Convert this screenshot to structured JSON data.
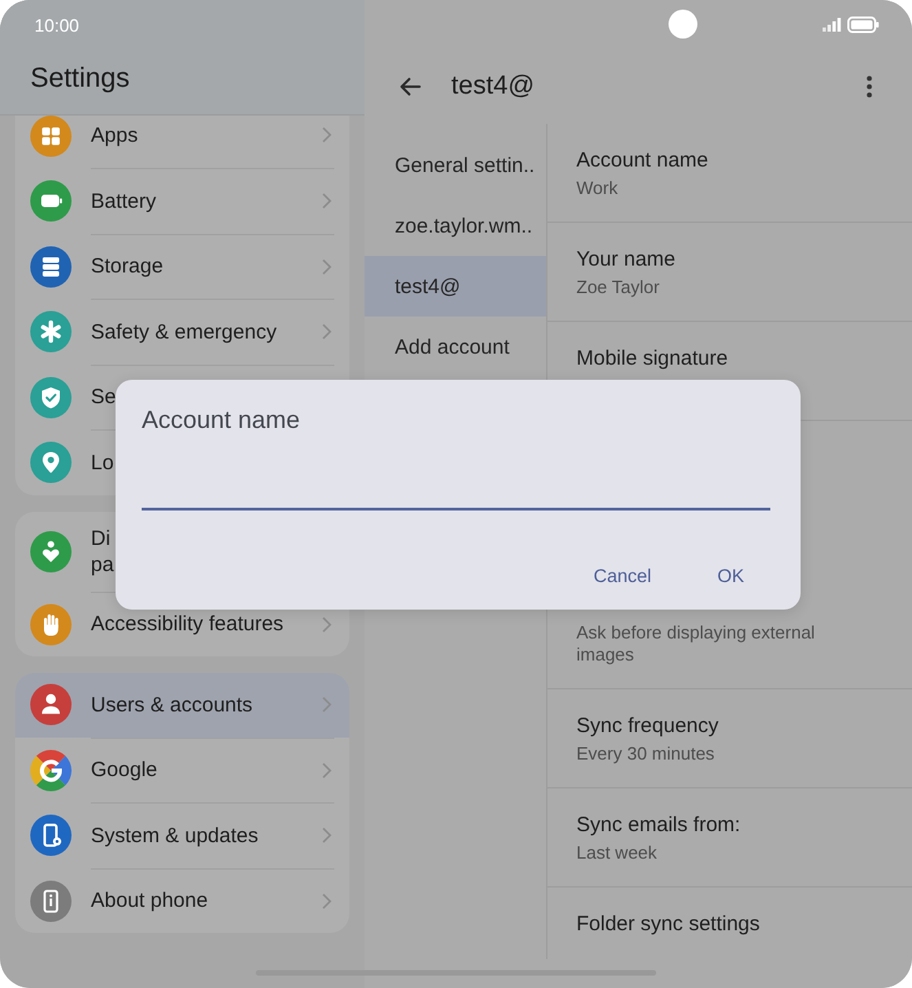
{
  "status_bar": {
    "time": "10:00"
  },
  "settings": {
    "title": "Settings",
    "groups": [
      {
        "items": [
          {
            "label": "Apps",
            "selected": false,
            "chevron": true
          },
          {
            "label": "Battery",
            "selected": false,
            "chevron": true
          },
          {
            "label": "Storage",
            "selected": false,
            "chevron": true
          },
          {
            "label": "Safety & emergency",
            "selected": false,
            "chevron": true
          },
          {
            "label": "Se",
            "selected": false,
            "chevron": false
          },
          {
            "label": "Lo",
            "selected": false,
            "chevron": false
          }
        ]
      },
      {
        "items": [
          {
            "label": "Di\npa",
            "selected": false,
            "chevron": false
          },
          {
            "label": "Accessibility features",
            "selected": false,
            "chevron": true
          }
        ]
      },
      {
        "items": [
          {
            "label": "Users & accounts",
            "selected": true,
            "chevron": true
          },
          {
            "label": "Google",
            "selected": false,
            "chevron": true
          },
          {
            "label": "System & updates",
            "selected": false,
            "chevron": true
          },
          {
            "label": "About phone",
            "selected": false,
            "chevron": true
          }
        ]
      }
    ]
  },
  "account": {
    "title": "test4@",
    "nav": [
      {
        "label": "General settin..",
        "selected": false
      },
      {
        "label": "zoe.taylor.wm..",
        "selected": false
      },
      {
        "label": "test4@",
        "selected": true
      },
      {
        "label": "Add account",
        "selected": false
      }
    ],
    "rows": [
      {
        "title": "Account name",
        "value": "Work"
      },
      {
        "title": "Your name",
        "value": "Zoe Taylor"
      },
      {
        "title": "Mobile signature"
      },
      {
        "value": "Ask before displaying external images"
      },
      {
        "title": "Sync frequency",
        "value": "Every 30 minutes"
      },
      {
        "title": "Sync emails from:",
        "value": "Last week"
      },
      {
        "title": "Folder sync settings"
      }
    ]
  },
  "dialog": {
    "title": "Account name",
    "buttons": [
      "Cancel",
      "OK"
    ]
  }
}
